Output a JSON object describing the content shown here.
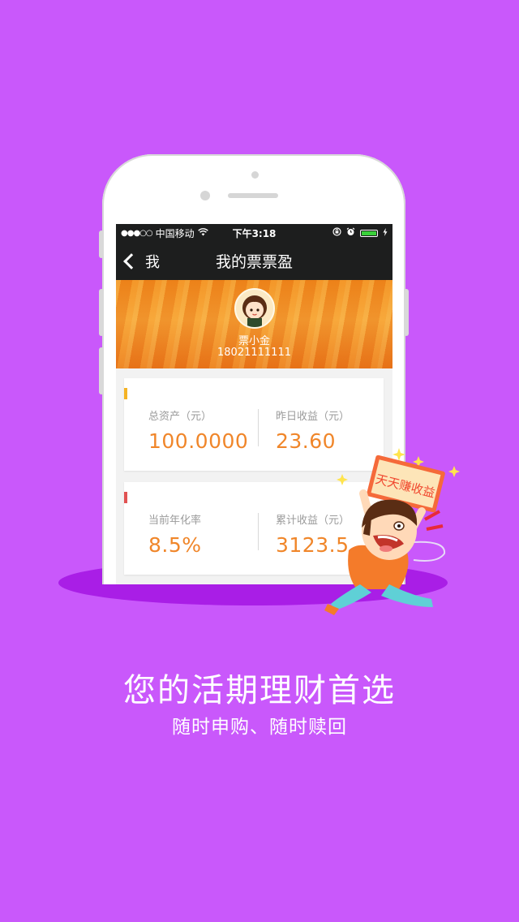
{
  "status_bar": {
    "signal": "●●●○○",
    "carrier": "中国移动",
    "time": "下午3:18",
    "icons": [
      "wifi-icon",
      "orientation-lock-icon",
      "alarm-icon",
      "battery-icon",
      "charging-icon"
    ]
  },
  "nav": {
    "back_label": "我",
    "title": "我的票票盈"
  },
  "profile": {
    "name": "票小金",
    "phone": "18021111111"
  },
  "cards": [
    {
      "accent": "#f5b324",
      "left_label": "总资产（元）",
      "left_value": "100.0000",
      "right_label": "昨日收益（元）",
      "right_value": "23.60"
    },
    {
      "accent": "#e15252",
      "left_label": "当前年化率",
      "left_value": "8.5%",
      "right_label": "累计收益（元）",
      "right_value": "3123.5"
    }
  ],
  "mascot": {
    "sign_text": "天天赚收益"
  },
  "promo": {
    "headline": "您的活期理财首选",
    "subline": "随时申购、随时赎回"
  },
  "colors": {
    "background": "#c958fb",
    "value_orange": "#f0862a",
    "nav_dark": "#1d1e1e"
  }
}
